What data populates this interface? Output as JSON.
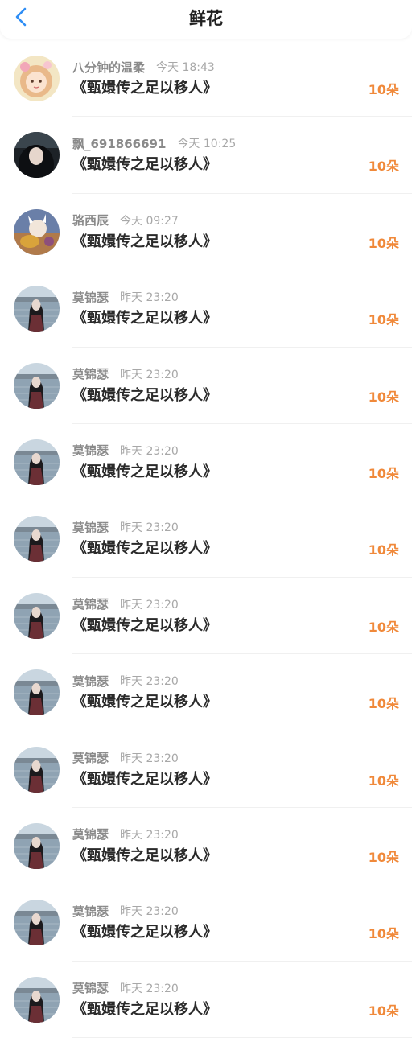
{
  "header": {
    "title": "鲜花",
    "back_icon": "chevron-left-icon",
    "accent_color": "#2f8ef5"
  },
  "colors": {
    "count": "#f0893a",
    "name": "#8a8a8a",
    "time": "#a8a8a8"
  },
  "list": [
    {
      "name": "八分钟的温柔",
      "time": "今天 18:43",
      "gift": "《甄嬛传之足以移人》",
      "count": "10朵",
      "avatar": "avatar-cartoon-girl"
    },
    {
      "name": "飘_691866691",
      "time": "今天 10:25",
      "gift": "《甄嬛传之足以移人》",
      "count": "10朵",
      "avatar": "avatar-dark-portrait"
    },
    {
      "name": "骆西辰",
      "time": "今天 09:27",
      "gift": "《甄嬛传之足以移人》",
      "count": "10朵",
      "avatar": "avatar-game-character"
    },
    {
      "name": "莫锦瑟",
      "time": "昨天 23:20",
      "gift": "《甄嬛传之足以移人》",
      "count": "10朵",
      "avatar": "avatar-lake-portrait"
    },
    {
      "name": "莫锦瑟",
      "time": "昨天 23:20",
      "gift": "《甄嬛传之足以移人》",
      "count": "10朵",
      "avatar": "avatar-lake-portrait"
    },
    {
      "name": "莫锦瑟",
      "time": "昨天 23:20",
      "gift": "《甄嬛传之足以移人》",
      "count": "10朵",
      "avatar": "avatar-lake-portrait"
    },
    {
      "name": "莫锦瑟",
      "time": "昨天 23:20",
      "gift": "《甄嬛传之足以移人》",
      "count": "10朵",
      "avatar": "avatar-lake-portrait"
    },
    {
      "name": "莫锦瑟",
      "time": "昨天 23:20",
      "gift": "《甄嬛传之足以移人》",
      "count": "10朵",
      "avatar": "avatar-lake-portrait"
    },
    {
      "name": "莫锦瑟",
      "time": "昨天 23:20",
      "gift": "《甄嬛传之足以移人》",
      "count": "10朵",
      "avatar": "avatar-lake-portrait"
    },
    {
      "name": "莫锦瑟",
      "time": "昨天 23:20",
      "gift": "《甄嬛传之足以移人》",
      "count": "10朵",
      "avatar": "avatar-lake-portrait"
    },
    {
      "name": "莫锦瑟",
      "time": "昨天 23:20",
      "gift": "《甄嬛传之足以移人》",
      "count": "10朵",
      "avatar": "avatar-lake-portrait"
    },
    {
      "name": "莫锦瑟",
      "time": "昨天 23:20",
      "gift": "《甄嬛传之足以移人》",
      "count": "10朵",
      "avatar": "avatar-lake-portrait"
    },
    {
      "name": "莫锦瑟",
      "time": "昨天 23:20",
      "gift": "《甄嬛传之足以移人》",
      "count": "10朵",
      "avatar": "avatar-lake-portrait"
    }
  ]
}
